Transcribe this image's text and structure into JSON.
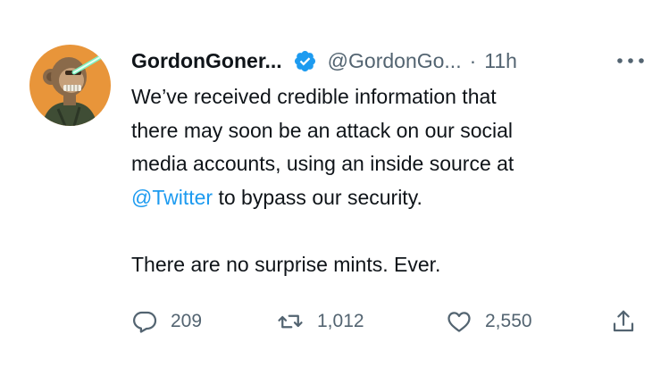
{
  "tweet": {
    "display_name": "GordonGoner...",
    "handle": "@GordonGo...",
    "separator": "·",
    "time": "11h",
    "lines_1": [
      "We’ve received credible information that",
      "there may soon be an attack on our social",
      "media accounts, using an inside source at"
    ],
    "mention": "@Twitter",
    "after_mention": " to bypass our security.",
    "line_2": "There are no surprise mints. Ever."
  },
  "actions": {
    "reply_count": "209",
    "retweet_count": "1,012",
    "like_count": "2,550"
  },
  "icons": {
    "verified": "verified-badge-icon",
    "more": "more-options-icon",
    "reply": "reply-icon",
    "retweet": "retweet-icon",
    "like": "heart-icon",
    "share": "share-icon"
  },
  "colors": {
    "accent": "#1d9bf0",
    "text": "#0f1419",
    "secondary": "#536471",
    "avatar_bg": "#e8953a"
  }
}
